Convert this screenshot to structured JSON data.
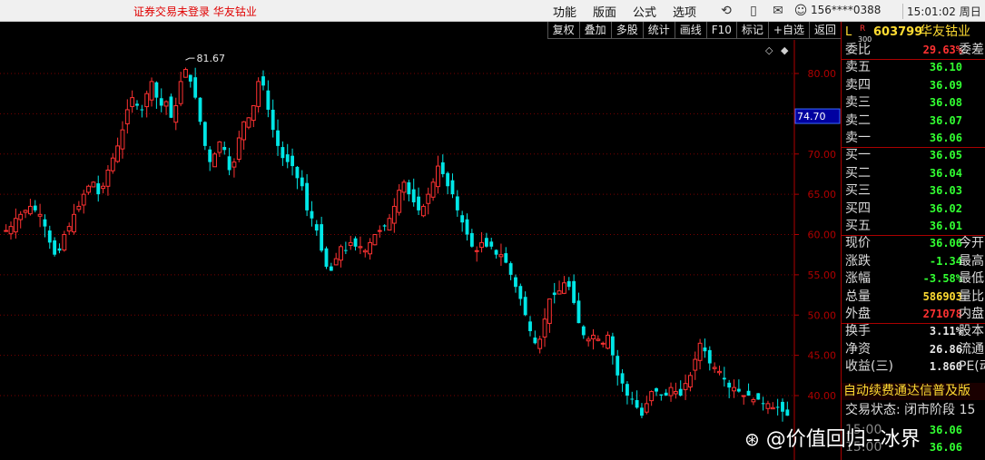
{
  "topbar": {
    "login_status": "证券交易未登录  华友钴业",
    "menu": [
      "功能",
      "版面",
      "公式",
      "选项"
    ],
    "user_id": "156****0388",
    "clock": "15:01:02 周日"
  },
  "chart_toolbar": [
    "复权",
    "叠加",
    "多股",
    "统计",
    "画线",
    "F10",
    "标记",
    "+自选",
    "返回"
  ],
  "crosshair_value": "74.70",
  "peak_label": "81.67",
  "chart_data": {
    "type": "candlestick",
    "y_ticks": [
      "80.00",
      "75.00",
      "70.00",
      "65.00",
      "60.00",
      "55.00",
      "50.00",
      "45.00",
      "40.00"
    ],
    "y_range": [
      36,
      84
    ],
    "peak": 81.67,
    "close_series": [
      60.5,
      61,
      62,
      62.5,
      63,
      63.5,
      63,
      62.5,
      61,
      59,
      57.5,
      58,
      60,
      61,
      62.5,
      63.5,
      65,
      66,
      66.5,
      65,
      66,
      68,
      69.5,
      71,
      73,
      75.5,
      77,
      76,
      75.5,
      77.5,
      79,
      77,
      76,
      76.5,
      74.5,
      76,
      79,
      80.5,
      79,
      77,
      74,
      71,
      69,
      70,
      71.5,
      70.5,
      68,
      69,
      72,
      74,
      74.5,
      76,
      79,
      78.5,
      75.5,
      73,
      71,
      69.5,
      69,
      68.5,
      67,
      66,
      63,
      62,
      60.5,
      58,
      56,
      55.5,
      57,
      58.5,
      58,
      59,
      58.5,
      58.5,
      58,
      59,
      60,
      60.5,
      61,
      62,
      63.5,
      65.5,
      66.5,
      65,
      64,
      63,
      63.5,
      65,
      66.5,
      68.5,
      67.5,
      66,
      65,
      63,
      61.5,
      60,
      58.5,
      58,
      59,
      58.5,
      58.5,
      57.5,
      57.5,
      56.5,
      55,
      53.5,
      52,
      50,
      48,
      46.5,
      47,
      49.5,
      52,
      52.5,
      53,
      54,
      53.5,
      51.5,
      49,
      47.5,
      47,
      47.5,
      47,
      46.5,
      47.5,
      45,
      42.5,
      41.5,
      40,
      39.5,
      38.5,
      37.5,
      39,
      40.5,
      40.5,
      40,
      40,
      41,
      40.5,
      40,
      41.5,
      42.5,
      44.5,
      46.5,
      45.5,
      44,
      43.5,
      43,
      42,
      41,
      41,
      40.5,
      40,
      40,
      39.5,
      39.5,
      39,
      39,
      38.5,
      38.5,
      38,
      37.5
    ]
  },
  "quote": {
    "title_l": "L",
    "title_r": "R",
    "title_r_sub": "300",
    "code": "603799",
    "name": "华友钴业",
    "rows": [
      {
        "label": "委比",
        "value": "29.63%",
        "extra": "委差",
        "color": "#ff3232"
      },
      {
        "label": "卖五",
        "value": "36.10",
        "extra": "",
        "color": "#32ff32"
      },
      {
        "label": "卖四",
        "value": "36.09",
        "extra": "",
        "color": "#32ff32"
      },
      {
        "label": "卖三",
        "value": "36.08",
        "extra": "",
        "color": "#32ff32"
      },
      {
        "label": "卖二",
        "value": "36.07",
        "extra": "",
        "color": "#32ff32"
      },
      {
        "label": "卖一",
        "value": "36.06",
        "extra": "",
        "color": "#32ff32"
      },
      {
        "label": "买一",
        "value": "36.05",
        "extra": "",
        "color": "#32ff32"
      },
      {
        "label": "买二",
        "value": "36.04",
        "extra": "",
        "color": "#32ff32"
      },
      {
        "label": "买三",
        "value": "36.03",
        "extra": "",
        "color": "#32ff32"
      },
      {
        "label": "买四",
        "value": "36.02",
        "extra": "",
        "color": "#32ff32"
      },
      {
        "label": "买五",
        "value": "36.01",
        "extra": "",
        "color": "#32ff32"
      },
      {
        "label": "现价",
        "value": "36.06",
        "extra": "今开",
        "color": "#32ff32"
      },
      {
        "label": "涨跌",
        "value": "-1.34",
        "extra": "最高",
        "color": "#32ff32"
      },
      {
        "label": "涨幅",
        "value": "-3.58%",
        "extra": "最低",
        "color": "#32ff32"
      },
      {
        "label": "总量",
        "value": "586903",
        "extra": "量比",
        "color": "#ffdc32"
      },
      {
        "label": "外盘",
        "value": "271078",
        "extra": "内盘",
        "color": "#ff3232"
      },
      {
        "label": "换手",
        "value": "3.11%",
        "extra": "股本",
        "color": "#e6e6e6"
      },
      {
        "label": "净资",
        "value": "26.86",
        "extra": "流通",
        "color": "#e6e6e6"
      },
      {
        "label": "收益(三)",
        "value": "1.860",
        "extra": "PE(动",
        "color": "#e6e6e6"
      }
    ],
    "notice": "自动续费通达信普及版",
    "trade_status": "交易状态: 闭市阶段 15",
    "bottom_rows": [
      {
        "label": "15:00",
        "value": "36.06",
        "color": "#32ff32"
      },
      {
        "label": "15:00",
        "value": "36.06",
        "color": "#32ff32"
      }
    ]
  },
  "watermark": "@价值回归--冰界"
}
